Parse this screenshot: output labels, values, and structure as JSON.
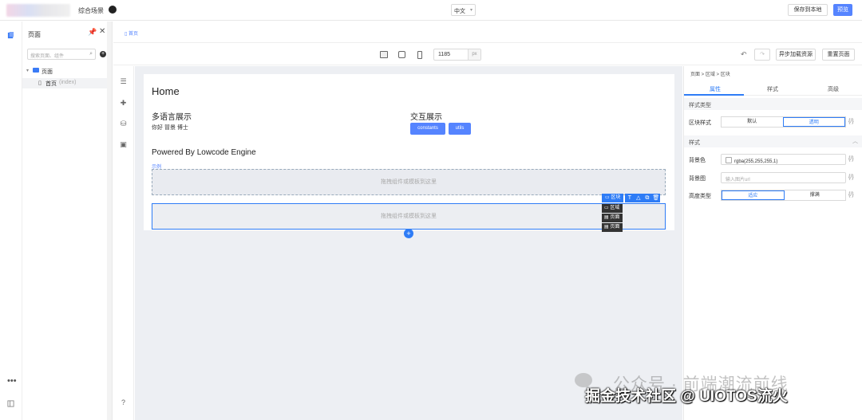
{
  "topbar": {
    "scene_title": "综合场景",
    "lang": "中文",
    "save_local": "保存到本地",
    "preview": "预览"
  },
  "pages_panel": {
    "title": "页面",
    "search_placeholder": "搜索页面、组件",
    "tree": [
      {
        "label": "页面",
        "kind": "folder"
      },
      {
        "label": "首页",
        "sub": "(index)",
        "kind": "page"
      }
    ]
  },
  "tabstrip": {
    "home_tab": "首页"
  },
  "toolbar": {
    "width_value": "1185",
    "width_unit": "px",
    "async_load": "异步加载资源",
    "reset_page": "重置页面"
  },
  "canvas": {
    "home_title": "Home",
    "i18n_title": "多语言展示",
    "i18n_text": "你好  冒景 博士",
    "interact_title": "交互展示",
    "btn_constants": "constants",
    "btn_utils": "utils",
    "powered": "Powered By Lowcode Engine",
    "link_small": "示例",
    "dropzone_hint": "拖拽组件或模板到这里",
    "selected_label": "区块",
    "crumb_pills": [
      "区域",
      "页面",
      "页面"
    ]
  },
  "settings_panel": {
    "breadcrumb": [
      "页面",
      "区域",
      "区块"
    ],
    "tabs": [
      "属性",
      "样式",
      "高级"
    ],
    "group_style_type": "样式类型",
    "block_style_label": "区块样式",
    "block_style_options": [
      "默认",
      "透明"
    ],
    "group_style": "样式",
    "bg_color_label": "背景色",
    "bg_color_value": "rgba(255,255,255,1)",
    "bg_image_label": "背景图",
    "bg_image_placeholder": "输入图片url",
    "height_type_label": "高度类型",
    "height_type_options": [
      "适应",
      "撑满"
    ],
    "var_btn": "{/}"
  },
  "watermark": {
    "line1": "公众号 · 前端潮流前线",
    "line2": "掘金技术社区 @ UIOTOS流火"
  },
  "colors": {
    "accent": "#5584ff",
    "selection": "#2e7cf6",
    "canvas": "#edeff3"
  }
}
